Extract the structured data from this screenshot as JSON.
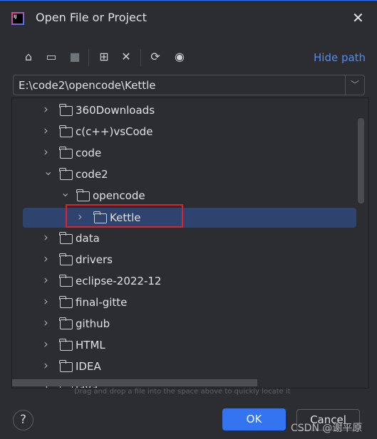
{
  "dialog": {
    "title": "Open File or Project",
    "close_icon": "close-icon",
    "logo": "IJ"
  },
  "toolbar": {
    "icons": [
      "home-icon",
      "desktop-icon",
      "project-folder-icon",
      "new-folder-icon",
      "delete-icon",
      "refresh-icon",
      "show-hidden-icon"
    ],
    "hide_path": "Hide path"
  },
  "path": {
    "value": "E:\\code2\\opencode\\Kettle"
  },
  "tree": {
    "items": [
      {
        "label": "360Downloads",
        "level": 0,
        "expanded": false
      },
      {
        "label": "c(c++)vsCode",
        "level": 0,
        "expanded": false
      },
      {
        "label": "code",
        "level": 0,
        "expanded": false
      },
      {
        "label": "code2",
        "level": 0,
        "expanded": true
      },
      {
        "label": "opencode",
        "level": 1,
        "expanded": true
      },
      {
        "label": "Kettle",
        "level": 2,
        "expanded": false,
        "selected": true
      },
      {
        "label": "data",
        "level": 0,
        "expanded": false
      },
      {
        "label": "drivers",
        "level": 0,
        "expanded": false
      },
      {
        "label": "eclipse-2022-12",
        "level": 0,
        "expanded": false
      },
      {
        "label": "final-gitte",
        "level": 0,
        "expanded": false
      },
      {
        "label": "github",
        "level": 0,
        "expanded": false
      },
      {
        "label": "HTML",
        "level": 0,
        "expanded": false
      },
      {
        "label": "IDEA",
        "level": 0,
        "expanded": false
      },
      {
        "label": "java",
        "level": 0,
        "expanded": false
      }
    ]
  },
  "hint": "Drag and drop a file into the space above to quickly locate it",
  "buttons": {
    "help": "?",
    "ok": "OK",
    "cancel": "Cancel"
  },
  "watermark": "CSDN @谢平原",
  "colors": {
    "accent": "#3574f0",
    "selection": "#2e436e",
    "link": "#548af7",
    "highlight_box": "#e0202a"
  }
}
